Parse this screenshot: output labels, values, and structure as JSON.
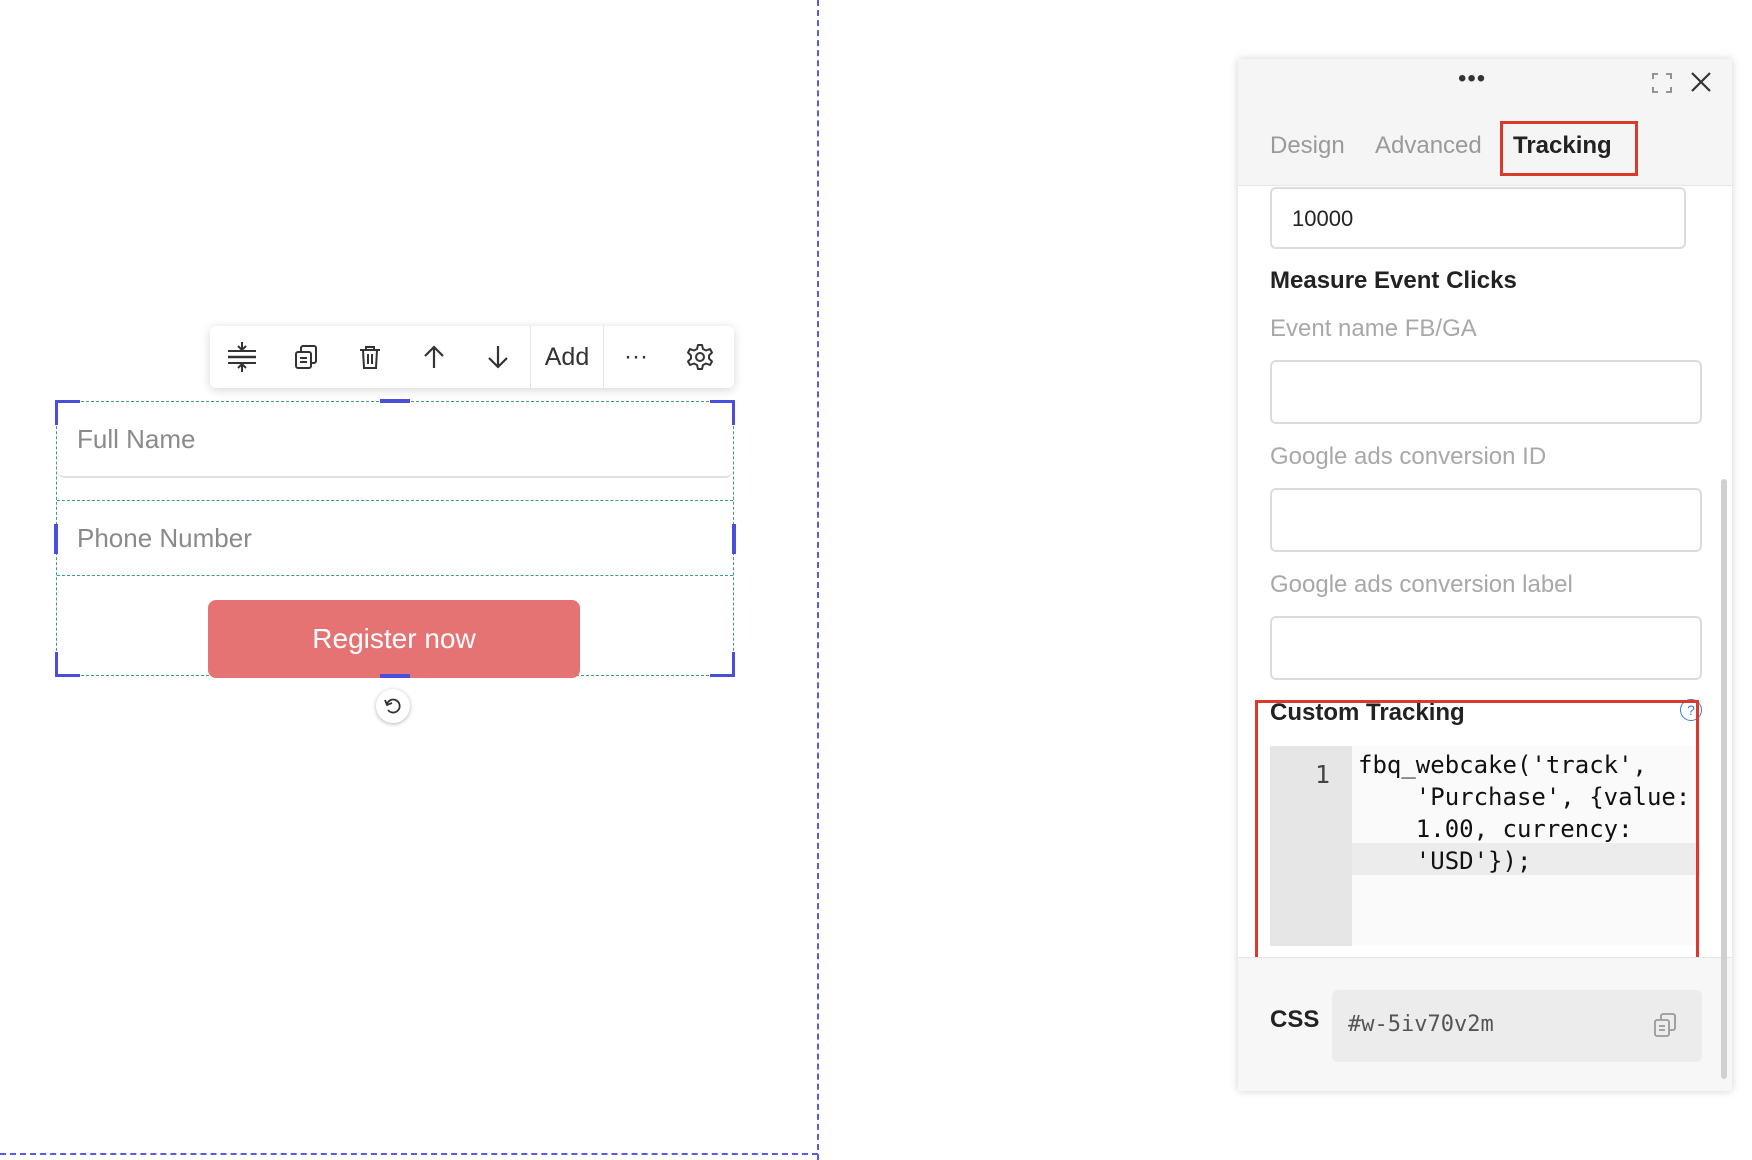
{
  "canvas": {
    "form": {
      "full_name_placeholder": "Full Name",
      "phone_placeholder": "Phone Number",
      "register_label": "Register now",
      "button_color": "#e57373"
    },
    "toolbar": {
      "icons": [
        "spacing-icon",
        "duplicate-icon",
        "trash-icon",
        "arrow-up-icon",
        "arrow-down-icon"
      ],
      "add_label": "Add",
      "more_label": "···",
      "settings_icon": "gear-icon"
    },
    "guide_color": "#5b5be0",
    "selection_color": "#4a4fdb"
  },
  "panel": {
    "menu_label": "•••",
    "tabs": [
      {
        "label": "Design",
        "active": false
      },
      {
        "label": "Advanced",
        "active": false
      },
      {
        "label": "Tracking",
        "active": true
      }
    ],
    "top_input_value": "10000",
    "measure_title": "Measure Event Clicks",
    "fields": [
      {
        "label": "Event name FB/GA",
        "value": ""
      },
      {
        "label": "Google ads conversion ID",
        "value": ""
      },
      {
        "label": "Google ads conversion label",
        "value": ""
      }
    ],
    "custom_tracking": {
      "title": "Custom Tracking",
      "help_icon": "?",
      "line_number": "1",
      "code": "fbq_webcake('track',\n    'Purchase', {value:\n    1.00, currency:\n    'USD'});"
    },
    "css": {
      "label": "CSS",
      "value": "#w-5iv70v2m"
    },
    "highlight_color": "#d93a2b"
  }
}
